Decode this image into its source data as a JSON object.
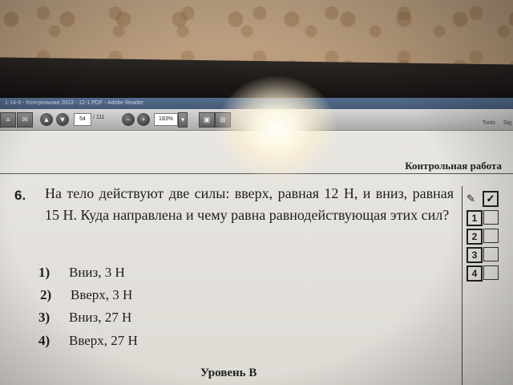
{
  "window": {
    "title": "1-14-6 - Контрольная 2013 - 12-1.PDF - Adobe Reader"
  },
  "toolbar": {
    "page_current": "54",
    "page_total": "/ 111",
    "zoom": "183%",
    "tools_label": "Tools",
    "sign_label": "Sig"
  },
  "document": {
    "header": "Контрольная работа",
    "question_number": "6.",
    "question_text": "На тело действуют две силы: вверх, равная 12 Н, и вниз, равная 15 Н. Куда направлена и чему равна равнодействующая этих сил?",
    "answers": [
      {
        "num": "1)",
        "text": "Вниз, 3 Н"
      },
      {
        "num": "2)",
        "text": "Вверх, 3 Н"
      },
      {
        "num": "3)",
        "text": "Вниз, 27 Н"
      },
      {
        "num": "4)",
        "text": "Вверх, 27 Н"
      }
    ],
    "level": "Уровень B",
    "answer_boxes": [
      "1",
      "2",
      "3",
      "4"
    ]
  }
}
